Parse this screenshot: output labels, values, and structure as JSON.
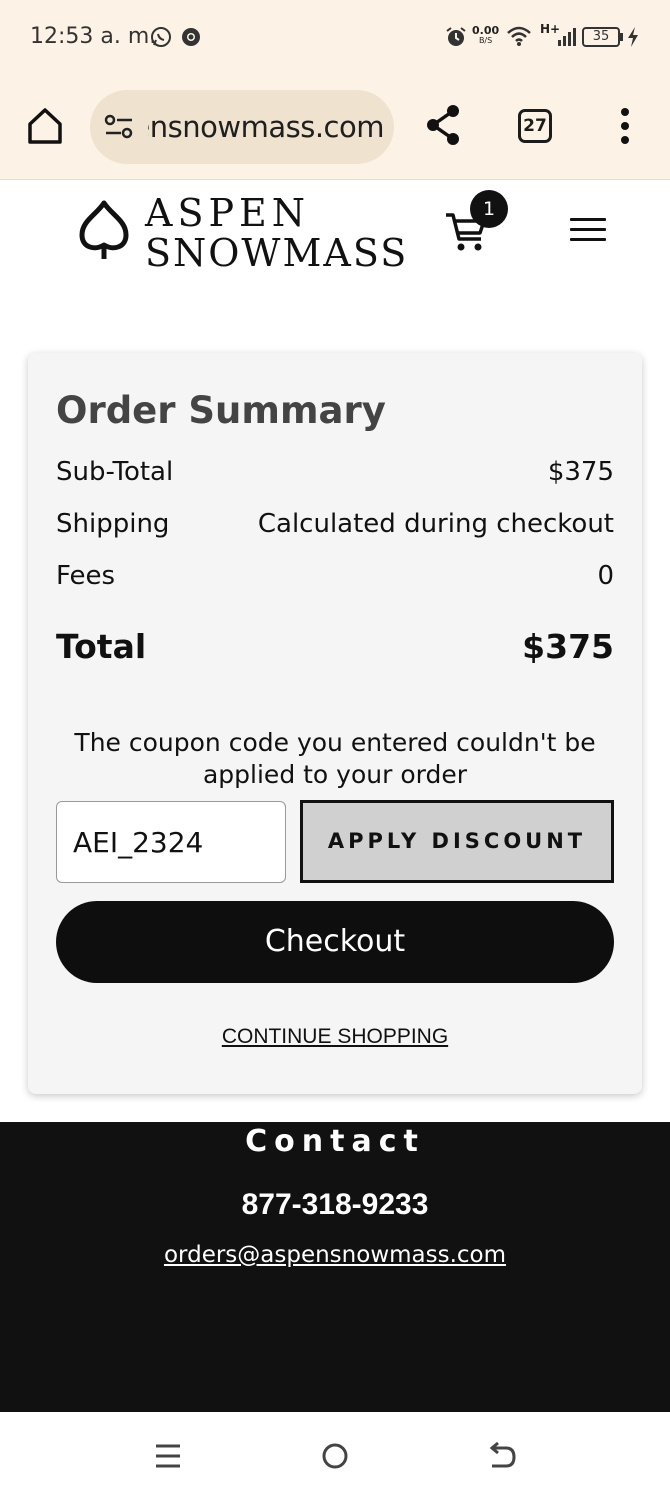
{
  "status_bar": {
    "time": "12:53 a. m.",
    "net_speed_value": "0.00",
    "net_speed_unit": "B/S",
    "network_type": "H+",
    "battery": "35"
  },
  "browser": {
    "url": "aspensnowmass.com",
    "url_visible": "​ınsnowmass.com",
    "tab_count": "27"
  },
  "header": {
    "logo_line1": "ASPEN",
    "logo_line2": "SNOWMASS",
    "cart_count": "1"
  },
  "summary": {
    "title": "Order Summary",
    "rows": [
      {
        "label": "Sub-Total",
        "value": "$375"
      },
      {
        "label": "Shipping",
        "value": "Calculated during checkout"
      },
      {
        "label": "Fees",
        "value": "0"
      }
    ],
    "total_label": "Total",
    "total_value": "$375",
    "coupon_message": "The coupon code you entered couldn't be applied to your order",
    "coupon_value": "AEI_2324",
    "apply_label": "APPLY DISCOUNT",
    "checkout_label": "Checkout",
    "continue_label": "CONTINUE SHOPPING"
  },
  "footer": {
    "title": "Contact",
    "phone": "877-318-9233",
    "email": "orders@aspensnowmass.com"
  },
  "colors": {
    "browser_chrome": "#fcf3e6",
    "url_pill": "#efe3cf",
    "footer_bg": "#111111",
    "button_dark": "#0e0e0e",
    "apply_bg": "#d0d0d0"
  },
  "icons": {
    "home": "home-icon",
    "site_info": "site-settings-icon",
    "share": "share-icon",
    "menu": "more-vert-icon",
    "cart": "cart-icon",
    "hamburger": "hamburger-menu-icon",
    "nav_recents": "recents-icon",
    "nav_home": "nav-home-icon",
    "nav_back": "back-icon"
  }
}
